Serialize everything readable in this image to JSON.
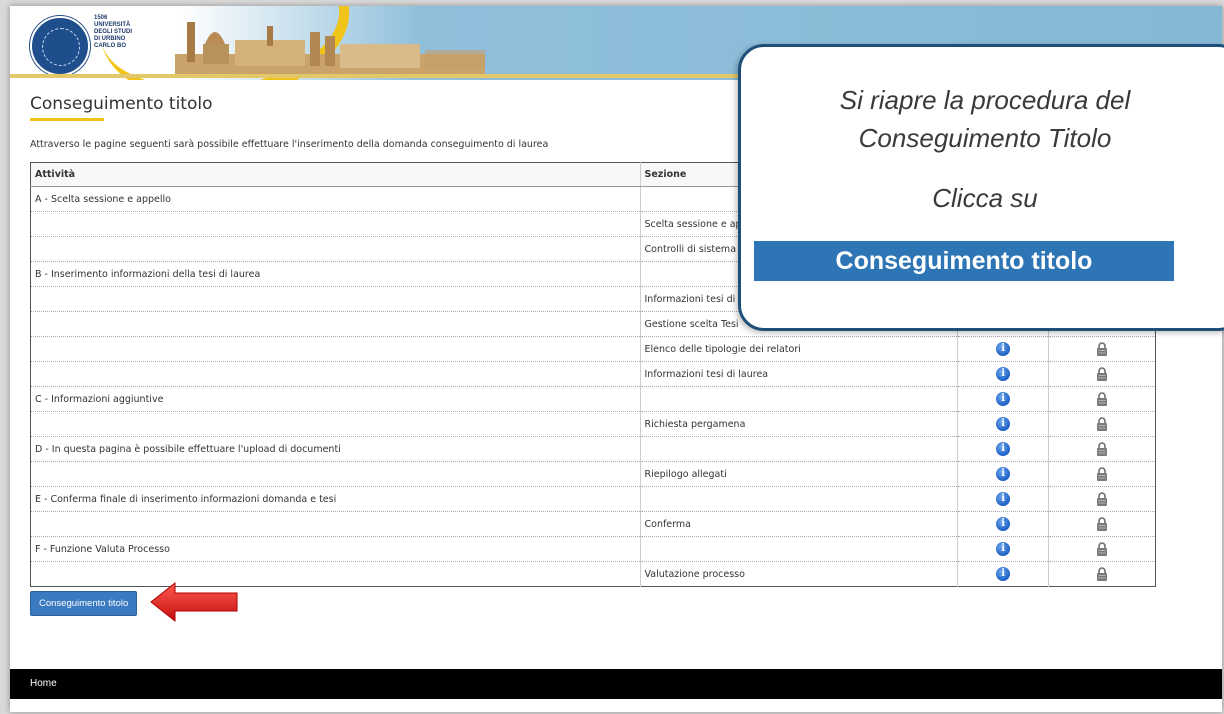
{
  "header": {
    "logo_year": "1506",
    "logo_text": "UNIVERSITÀ\nDEGLI STUDI\nDI URBINO\nCARLO BO"
  },
  "page": {
    "title": "Conseguimento titolo",
    "intro": "Attraverso le pagine seguenti sarà possibile effettuare l'inserimento della domanda conseguimento di laurea"
  },
  "table": {
    "headers": {
      "activity": "Attività",
      "section": "Sezione"
    },
    "rows": [
      {
        "activity": "A - Scelta sessione e appello",
        "section": ""
      },
      {
        "activity": "",
        "section": "Scelta sessione e appello"
      },
      {
        "activity": "",
        "section": "Controlli di sistema"
      },
      {
        "activity": "B - Inserimento informazioni della tesi di laurea",
        "section": ""
      },
      {
        "activity": "",
        "section": "Informazioni tesi di laurea"
      },
      {
        "activity": "",
        "section": "Gestione scelta Tesi"
      },
      {
        "activity": "",
        "section": "Elenco delle tipologie dei relatori"
      },
      {
        "activity": "",
        "section": "Informazioni tesi di laurea"
      },
      {
        "activity": "C - Informazioni aggiuntive",
        "section": ""
      },
      {
        "activity": "",
        "section": "Richiesta pergamena"
      },
      {
        "activity": "D - In questa pagina è possibile effettuare l'upload di documenti",
        "section": ""
      },
      {
        "activity": "",
        "section": "Riepilogo allegati"
      },
      {
        "activity": "E - Conferma finale di inserimento informazioni domanda e tesi",
        "section": ""
      },
      {
        "activity": "",
        "section": "Conferma"
      },
      {
        "activity": "F - Funzione Valuta Processo",
        "section": ""
      },
      {
        "activity": "",
        "section": "Valutazione processo"
      }
    ],
    "info_icon": "info-icon",
    "status_icon": "lock-icon"
  },
  "actions": {
    "primary_button": "Conseguimento titolo"
  },
  "footer": {
    "home": "Home"
  },
  "callout": {
    "line1": "Si riapre la procedura del",
    "line2": "Conseguimento Titolo",
    "line3": "Clicca su",
    "highlight": "Conseguimento titolo"
  },
  "colors": {
    "accent_yellow": "#f0c419",
    "button_blue": "#3a7ac0",
    "callout_border": "#1f4e79",
    "callout_highlight": "#2e75b6",
    "arrow_red": "#e21b1b"
  }
}
